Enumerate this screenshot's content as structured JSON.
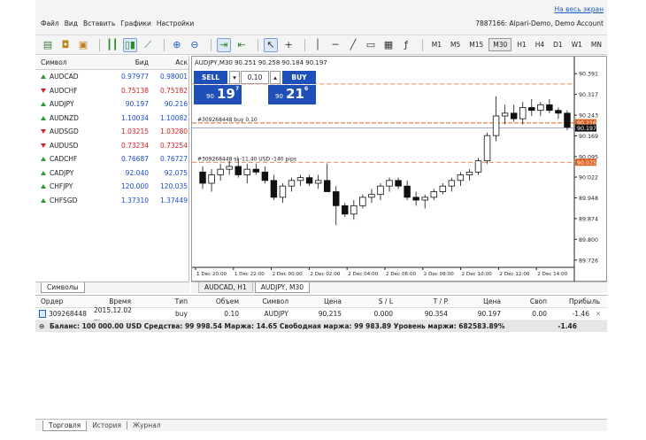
{
  "topbar": {
    "fullscreen_link": "На весь экран",
    "menu": [
      "Файл",
      "Вид",
      "Вставить",
      "Графики",
      "Настройки"
    ],
    "account": "7887166: Alpari-Demo, Demo Account"
  },
  "toolbar": {
    "timeframes": [
      "M1",
      "M5",
      "M15",
      "M30",
      "H1",
      "H4",
      "D1",
      "W1",
      "MN"
    ],
    "selected_timeframe": "M30"
  },
  "market_watch": {
    "headers": {
      "symbol": "Символ",
      "bid": "Бид",
      "ask": "Аск"
    },
    "rows": [
      {
        "symbol": "AUDCAD",
        "dir": "up",
        "bid": "0.97977",
        "ask": "0.98001",
        "color": "blue"
      },
      {
        "symbol": "AUDCHF",
        "dir": "down",
        "bid": "0.75138",
        "ask": "0.75182",
        "color": "red"
      },
      {
        "symbol": "AUDJPY",
        "dir": "up",
        "bid": "90.197",
        "ask": "90.216",
        "color": "blue"
      },
      {
        "symbol": "AUDNZD",
        "dir": "up",
        "bid": "1.10034",
        "ask": "1.10082",
        "color": "blue"
      },
      {
        "symbol": "AUDSGD",
        "dir": "down",
        "bid": "1.03215",
        "ask": "1.03280",
        "color": "red"
      },
      {
        "symbol": "AUDUSD",
        "dir": "down",
        "bid": "0.73234",
        "ask": "0.73254",
        "color": "red"
      },
      {
        "symbol": "CADCHF",
        "dir": "up",
        "bid": "0.76687",
        "ask": "0.76727",
        "color": "blue"
      },
      {
        "symbol": "CADJPY",
        "dir": "up",
        "bid": "92.040",
        "ask": "92.075",
        "color": "blue"
      },
      {
        "symbol": "CHFJPY",
        "dir": "up",
        "bid": "120.000",
        "ask": "120.035",
        "color": "blue"
      },
      {
        "symbol": "CHFSGD",
        "dir": "up",
        "bid": "1.37310",
        "ask": "1.37449",
        "color": "blue"
      }
    ],
    "tab": "Символы"
  },
  "chart": {
    "info": "AUDJPY,M30  90.251 90.258 90.184 90.197",
    "sell_label": "SELL",
    "buy_label": "BUY",
    "lot": "0.10",
    "sell_price_small": "90",
    "sell_price_big": "19",
    "sell_price_sup": "7",
    "buy_price_small": "90",
    "buy_price_big": "21",
    "buy_price_sup": "6",
    "order_line_label": "#309268448 buy 0.10",
    "sl_line_label": "#309268448 sl  -11.40 USD -140 pips",
    "price_labels": [
      "90.391",
      "90.317",
      "90.243",
      "90.169",
      "90.095",
      "90.022",
      "89.948",
      "89.874",
      "89.800",
      "89.726"
    ],
    "highlight_labels": [
      "90.216",
      "90.197",
      "90.075"
    ],
    "time_labels": [
      "1 Dec 20:00",
      "1 Dec 22:00",
      "2 Dec 00:00",
      "2 Dec 02:00",
      "2 Dec 04:00",
      "2 Dec 06:00",
      "2 Dec 08:00",
      "2 Dec 10:00",
      "2 Dec 12:00",
      "2 Dec 14:00"
    ],
    "tabs": [
      "AUDCAD, H1",
      "AUDJPY, M30"
    ],
    "selected_tab": "AUDJPY, M30",
    "candles": [
      [
        90.04,
        90.06,
        89.98,
        90.0
      ],
      [
        90.0,
        90.05,
        89.97,
        90.03
      ],
      [
        90.03,
        90.07,
        90.01,
        90.05
      ],
      [
        90.05,
        90.08,
        90.03,
        90.06
      ],
      [
        90.06,
        90.09,
        90.02,
        90.03
      ],
      [
        90.03,
        90.07,
        90.0,
        90.05
      ],
      [
        90.05,
        90.07,
        90.03,
        90.04
      ],
      [
        90.04,
        90.06,
        90.0,
        90.01
      ],
      [
        90.01,
        90.03,
        89.94,
        89.95
      ],
      [
        89.95,
        90.0,
        89.93,
        89.99
      ],
      [
        89.99,
        90.02,
        89.97,
        90.01
      ],
      [
        90.01,
        90.03,
        89.99,
        90.02
      ],
      [
        90.02,
        90.03,
        89.99,
        90.0
      ],
      [
        90.0,
        90.03,
        89.98,
        90.01
      ],
      [
        90.01,
        90.07,
        89.97,
        89.97
      ],
      [
        89.97,
        89.99,
        89.85,
        89.92
      ],
      [
        89.92,
        89.93,
        89.88,
        89.89
      ],
      [
        89.89,
        89.94,
        89.87,
        89.92
      ],
      [
        89.92,
        89.96,
        89.91,
        89.95
      ],
      [
        89.95,
        89.98,
        89.93,
        89.96
      ],
      [
        89.96,
        90.0,
        89.94,
        89.99
      ],
      [
        89.99,
        90.02,
        89.97,
        90.01
      ],
      [
        90.01,
        90.02,
        89.98,
        89.99
      ],
      [
        89.99,
        90.01,
        89.94,
        89.95
      ],
      [
        89.95,
        89.97,
        89.92,
        89.94
      ],
      [
        89.94,
        89.96,
        89.91,
        89.95
      ],
      [
        89.95,
        89.98,
        89.94,
        89.97
      ],
      [
        89.97,
        90.0,
        89.96,
        89.99
      ],
      [
        89.99,
        90.02,
        89.97,
        90.01
      ],
      [
        90.01,
        90.04,
        89.99,
        90.03
      ],
      [
        90.03,
        90.05,
        90.01,
        90.04
      ],
      [
        90.04,
        90.09,
        90.03,
        90.08
      ],
      [
        90.08,
        90.18,
        90.07,
        90.17
      ],
      [
        90.17,
        90.31,
        90.15,
        90.24
      ],
      [
        90.24,
        90.28,
        90.21,
        90.25
      ],
      [
        90.25,
        90.28,
        90.22,
        90.23
      ],
      [
        90.23,
        90.29,
        90.21,
        90.27
      ],
      [
        90.27,
        90.3,
        90.24,
        90.26
      ],
      [
        90.26,
        90.29,
        90.24,
        90.28
      ],
      [
        90.28,
        90.3,
        90.25,
        90.26
      ],
      [
        90.26,
        90.27,
        90.23,
        90.25
      ],
      [
        90.25,
        90.26,
        90.19,
        90.2
      ]
    ]
  },
  "terminal": {
    "headers": [
      "Ордер",
      "Время",
      "Тип",
      "Объем",
      "Символ",
      "Цена",
      "S / L",
      "T / P",
      "Цена",
      "Своп",
      "Прибыль"
    ],
    "row": [
      "309268448",
      "2015.12.02 ...",
      "buy",
      "0.10",
      "AUDJPY",
      "90.215",
      "0.000",
      "90.354",
      "90.197",
      "0.00",
      "-1.46"
    ],
    "balance_text": "Баланс: 100 000.00 USD  Средства: 99 998.54  Маржа: 14.65  Свободная маржа: 99 983.89  Уровень маржи: 682583.89%",
    "balance_profit": "-1.46",
    "tabs": [
      "Торговля",
      "История",
      "Журнал"
    ],
    "selected_tab": "Торговля"
  }
}
